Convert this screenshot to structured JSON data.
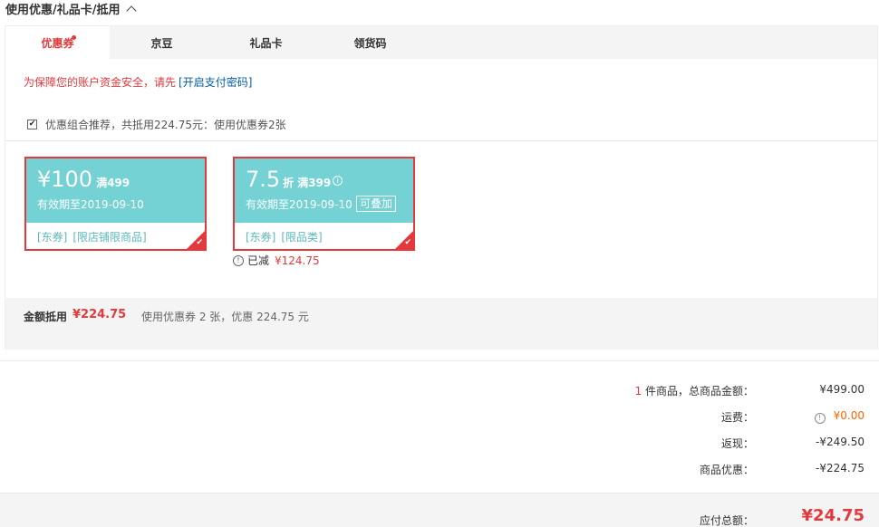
{
  "section": {
    "title": "使用优惠/礼品卡/抵用"
  },
  "tabs": [
    {
      "label": "优惠券"
    },
    {
      "label": "京豆"
    },
    {
      "label": "礼品卡"
    },
    {
      "label": "领货码"
    }
  ],
  "tip": {
    "text": "为保障您的账户资金安全，请先",
    "link": "[开启支付密码]"
  },
  "combo": {
    "checked": true,
    "text": "优惠组合推荐，共抵用224.75元：使用优惠券2张"
  },
  "coupons": [
    {
      "amount": "¥100",
      "unit": "",
      "condition": "满499",
      "validity": "有效期至2019-09-10",
      "tags": [
        "[东券]",
        "[限店铺限商品]"
      ],
      "selected": true
    },
    {
      "amount": "7.5",
      "unit": "折",
      "condition": "满399",
      "validity": "有效期至2019-09-10",
      "stackable": "可叠加",
      "tags": [
        "[东券]",
        "[限品类]"
      ],
      "selected": true
    }
  ],
  "reduced": {
    "label": "已减",
    "amount": "¥124.75"
  },
  "summary": {
    "label": "金额抵用",
    "value": "¥224.75",
    "desc": "使用优惠券 2 张，优惠 224.75 元"
  },
  "order": {
    "items_count": "1",
    "items_label": " 件商品，总商品金额：",
    "items_total": "¥499.00",
    "shipping_label": "运费：",
    "shipping_value": "¥0.00",
    "cashback_label": "返现：",
    "cashback_value": "-¥249.50",
    "discount_label": "商品优惠：",
    "discount_value": "-¥224.75",
    "payable_label": "应付总额：",
    "payable_value": "¥24.75"
  },
  "colors": {
    "accent": "#e4393c",
    "coupon_bg": "#74d2d4",
    "orange": "#ff6600"
  }
}
